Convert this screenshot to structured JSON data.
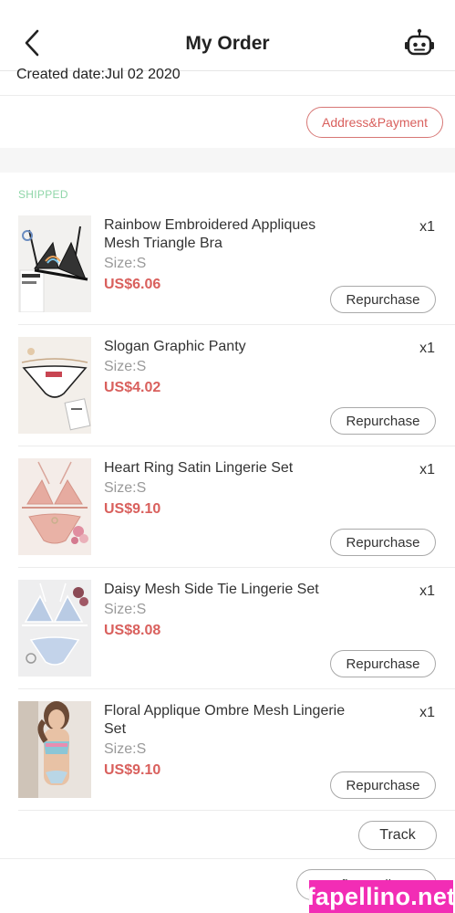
{
  "header": {
    "title": "My Order",
    "back_icon": "chevron-left-icon",
    "assistant_icon": "robot-icon"
  },
  "order": {
    "created": "Created date:Jul 02 2020",
    "address_payment_label": "Address&Payment"
  },
  "status": "SHIPPED",
  "items": [
    {
      "name": "Rainbow Embroidered Appliques Mesh Triangle Bra",
      "size": "Size:S",
      "price": "US$6.06",
      "qty": "x1",
      "repurchase": "Repurchase"
    },
    {
      "name": "Slogan Graphic Panty",
      "size": "Size:S",
      "price": "US$4.02",
      "qty": "x1",
      "repurchase": "Repurchase"
    },
    {
      "name": "Heart Ring Satin Lingerie Set",
      "size": "Size:S",
      "price": "US$9.10",
      "qty": "x1",
      "repurchase": "Repurchase"
    },
    {
      "name": "Daisy Mesh Side Tie Lingerie Set",
      "size": "Size:S",
      "price": "US$8.08",
      "qty": "x1",
      "repurchase": "Repurchase"
    },
    {
      "name": "Floral Applique Ombre Mesh Lingerie Set",
      "size": "Size:S",
      "price": "US$9.10",
      "qty": "x1",
      "repurchase": "Repurchase"
    }
  ],
  "actions": {
    "track": "Track",
    "confirm_delivery": "Confirm Delivery"
  },
  "watermark": "fapellino.net",
  "colors": {
    "accent": "#d9605d",
    "status": "#8fd6a8",
    "watermark_bg": "#f22db5"
  }
}
